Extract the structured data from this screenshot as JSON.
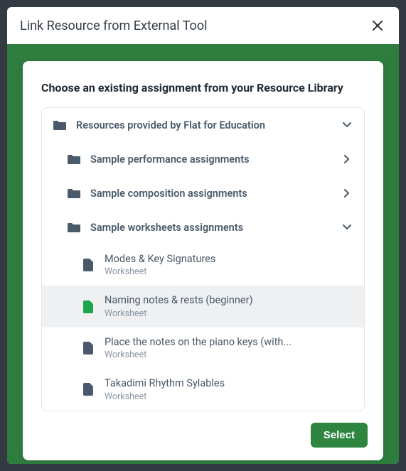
{
  "modal": {
    "title": "Link Resource from External Tool"
  },
  "picker": {
    "heading": "Choose an existing assignment from your Resource Library",
    "root": {
      "label": "Resources provided by Flat for Education",
      "expanded": true,
      "children": [
        {
          "label": "Sample performance assignments",
          "expanded": false,
          "type": "folder"
        },
        {
          "label": "Sample composition assignments",
          "expanded": false,
          "type": "folder"
        },
        {
          "label": "Sample worksheets assignments",
          "expanded": true,
          "type": "folder",
          "items": [
            {
              "title": "Modes & Key Signatures",
              "subtitle": "Worksheet",
              "selected": false
            },
            {
              "title": "Naming notes & rests (beginner)",
              "subtitle": "Worksheet",
              "selected": true
            },
            {
              "title": "Place the notes on the piano keys (with...",
              "subtitle": "Worksheet",
              "selected": false
            },
            {
              "title": "Takadimi Rhythm Sylables",
              "subtitle": "Worksheet",
              "selected": false
            }
          ]
        }
      ]
    },
    "select_label": "Select"
  }
}
